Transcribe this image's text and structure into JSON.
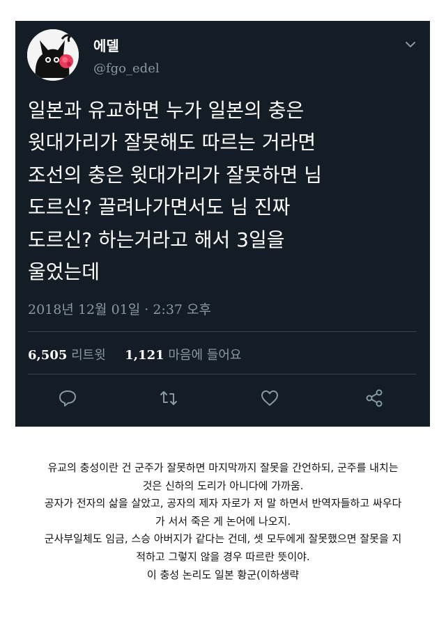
{
  "tweet": {
    "display_name": "에델",
    "handle": "@fgo_edel",
    "body_lines": [
      "일본과 유교하면 누가 일본의 충은",
      "윗대가리가 잘못해도 따르는 거라면",
      "조선의 충은 윗대가리가 잘못하면 님",
      "도르신? 끌려나가면서도 님 진짜",
      "도르신? 하는거라고 해서 3일을",
      "울었는데"
    ],
    "timestamp": "2018년 12월 01일 · 2:37 오후",
    "retweet_count": "6,505",
    "retweet_label": "리트윗",
    "like_count": "1,121",
    "like_label": "마음에 들어요",
    "icons": {
      "avatar": "black-cat-avatar",
      "caret": "chevron-down-icon",
      "reply": "reply-icon",
      "retweet": "retweet-icon",
      "like": "heart-icon",
      "share": "share-icon"
    }
  },
  "caption_lines": [
    "유교의 충성이란 건 군주가 잘못하면 마지막까지 잘못을 간언하되, 군주를 내치는",
    "것은 신하의 도리가 아니다에 가까움.",
    "공자가 전자의 삶을 살았고, 공자의 제자 자로가 저 말 하면서 반역자들하고 싸우다",
    "가 서서 죽은 게 논어에 나오지.",
    "군사부일체도 임금, 스승 아버지가 같다는 건데, 셋 모두에게 잘못했으면 잘못을 지",
    "적하고 그렇지 않을 경우 따르란 뜻이야.",
    "이 충성 논리도 일본 황군(이하생략"
  ],
  "colors": {
    "card_background": "#141d26",
    "muted_text": "#8899a6",
    "primary_text": "#ffffff",
    "divider": "#38444d",
    "caption_text": "#111111"
  }
}
